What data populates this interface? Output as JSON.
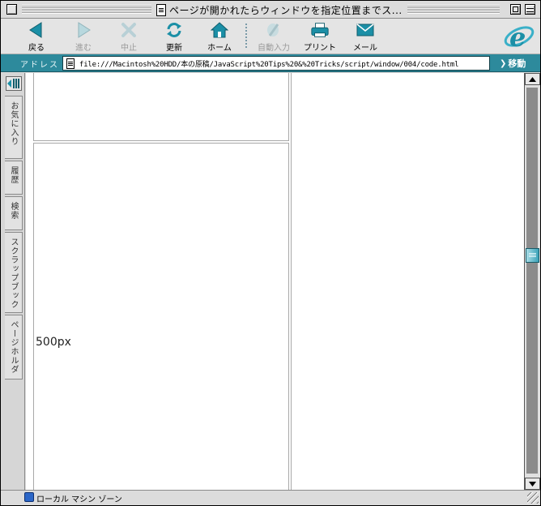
{
  "window": {
    "title": "ページが開かれたらウィンドウを指定位置までス..."
  },
  "toolbar": {
    "back_label": "戻る",
    "forward_label": "進む",
    "stop_label": "中止",
    "refresh_label": "更新",
    "home_label": "ホーム",
    "autofill_label": "自動入力",
    "print_label": "プリント",
    "mail_label": "メール",
    "accent_color": "#1b8fa6"
  },
  "address": {
    "label": "アドレス :",
    "url": "file:///Macintosh%20HDD/本の原稿/JavaScript%20Tips%20&%20Tricks/script/window/004/code.html",
    "go_label": "移動"
  },
  "sidebar": {
    "tabs": [
      "お気に入り",
      "履歴",
      "検索",
      "スクラップブック",
      "ページホルダ"
    ]
  },
  "content": {
    "frame_label": "500px"
  },
  "status": {
    "zone": "ローカル マシン ゾーン"
  }
}
